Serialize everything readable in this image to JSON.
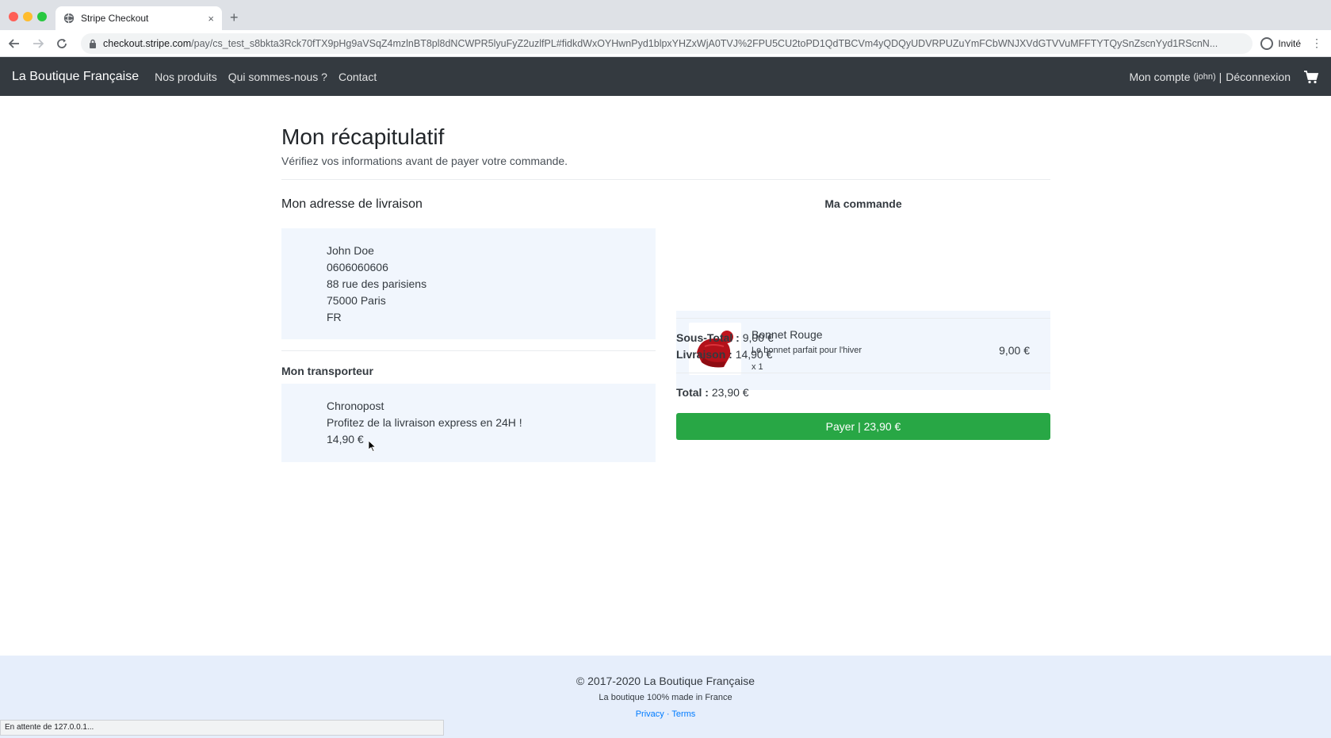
{
  "browser": {
    "tab_title": "Stripe Checkout",
    "tab_close": "×",
    "new_tab": "+",
    "url_host": "checkout.stripe.com",
    "url_path": "/pay/cs_test_s8bkta3Rck70fTX9pHg9aVSqZ4mzlnBT8pl8dNCWPR5lyuFyZ2uzlfPL#fidkdWxOYHwnPyd1blpxYHZxWjA0TVJ%2FPU5CU2toPD1QdTBCVm4yQDQyUDVRPUZuYmFCbWNJXVdGTVVuMFFTYTQySnZscnYyd1RScnN...",
    "profile_label": "Invité",
    "status_text": "En attente de 127.0.0.1..."
  },
  "nav": {
    "brand": "La Boutique Française",
    "links": [
      "Nos produits",
      "Qui sommes-nous ?",
      "Contact"
    ],
    "account": "Mon compte",
    "account_user": "(john)",
    "separator": "|",
    "logout": "Déconnexion"
  },
  "page": {
    "title": "Mon récapitulatif",
    "subtitle": "Vérifiez vos informations avant de payer votre commande."
  },
  "address": {
    "section_title": "Mon adresse de livraison",
    "lines": [
      "John Doe",
      "0606060606",
      "88 rue des parisiens",
      "75000 Paris",
      "FR"
    ]
  },
  "carrier": {
    "section_title": "Mon transporteur",
    "lines": [
      "Chronopost",
      "Profitez de la livraison express en 24H !",
      "14,90 €"
    ]
  },
  "order": {
    "section_title": "Ma commande",
    "product": {
      "name": "Bonnet Rouge",
      "description": "Le bonnet parfait pour l'hiver",
      "quantity": "x 1",
      "price": "9,00 €"
    },
    "subtotal_label": "Sous-Total :",
    "subtotal_value": "9,00 €",
    "shipping_label": "Livraison :",
    "shipping_value": "14,90 €",
    "total_label": "Total :",
    "total_value": "23,90 €",
    "pay_button": "Payer | 23,90 €"
  },
  "footer": {
    "copyright": "© 2017-2020 La Boutique Française",
    "tagline": "La boutique 100% made in France",
    "privacy": "Privacy",
    "link_separator": "·",
    "terms": "Terms"
  },
  "colors": {
    "navbar": "#343a40",
    "pay_button": "#28a745",
    "box_bg": "#f1f6fd",
    "footer_bg": "#e6eefb",
    "link": "#007bff"
  }
}
